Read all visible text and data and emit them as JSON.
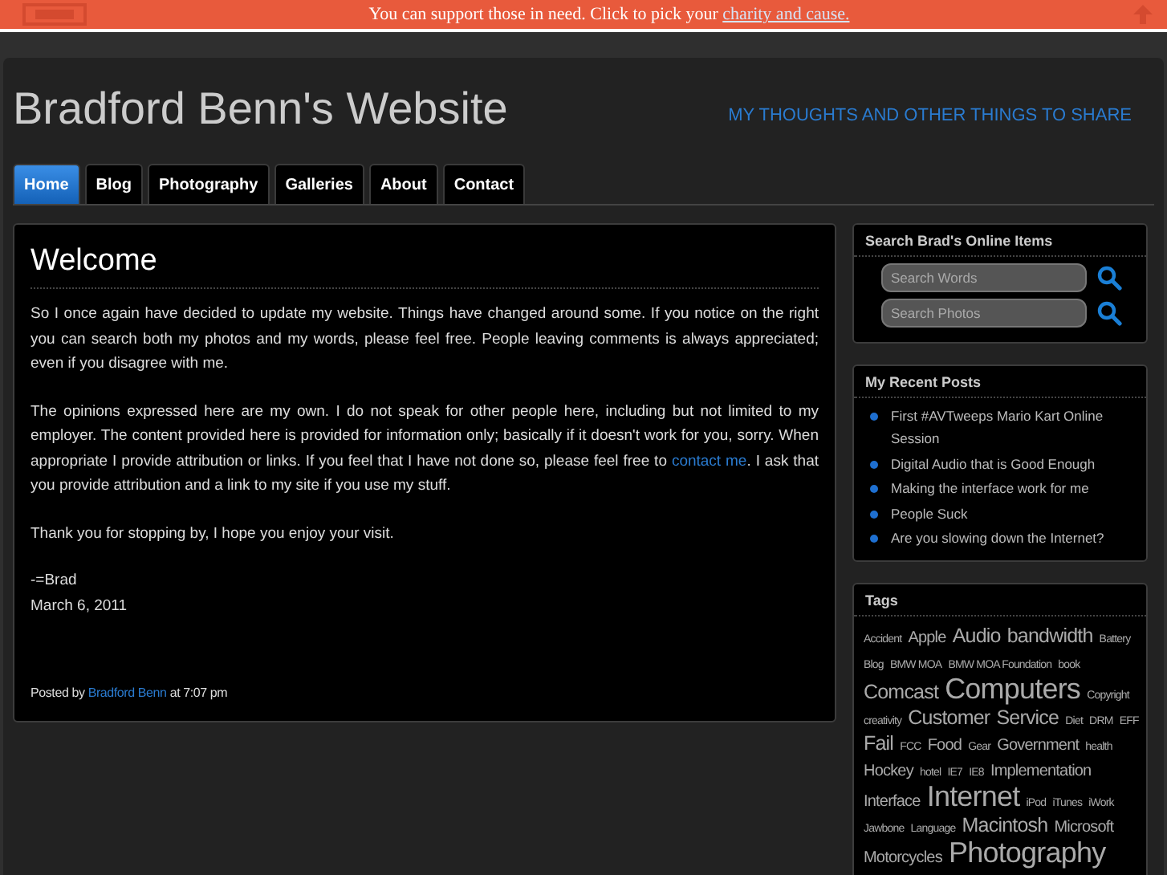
{
  "banner": {
    "text": "You can support those in need. Click to pick your ",
    "link": "charity and cause."
  },
  "header": {
    "title": "Bradford Benn's Website",
    "tagline": "MY THOUGHTS AND OTHER THINGS TO SHARE"
  },
  "tabs": [
    {
      "label": "Home",
      "selected": true
    },
    {
      "label": "Blog",
      "selected": false
    },
    {
      "label": "Photography",
      "selected": false
    },
    {
      "label": "Galleries",
      "selected": false
    },
    {
      "label": "About",
      "selected": false
    },
    {
      "label": "Contact",
      "selected": false
    }
  ],
  "post": {
    "title": "Welcome",
    "paragraphs": [
      [
        "So I once again have decided to update my website. Things have changed around some. If you notice on the right you can search both my photos and my words, please feel free. People leaving comments is always appreciated; even if you disagree with me."
      ],
      [
        "The opinions expressed here are my own. I do not speak for other people here, including but not limited to my employer. The content provided here is provided for information only; basically if it doesn't work for you, sorry. When appropriate I provide attribution or links. If you feel that I have not done so, please feel free to ",
        "contact me",
        ". I ask that you provide attribution and a link to my site if you use my stuff."
      ],
      [
        "Thank you for stopping by, I hope you enjoy your visit."
      ]
    ],
    "signature": [
      "-=Brad",
      "March 6, 2011"
    ],
    "footer": {
      "prefix": "Posted by ",
      "author": "Bradford Benn",
      "suffix": " at 7:07 pm"
    }
  },
  "search_widget": {
    "title": "Search Brad's Online Items",
    "fields": [
      {
        "placeholder": "Search Words"
      },
      {
        "placeholder": "Search Photos"
      }
    ]
  },
  "recent_posts": {
    "title": "My Recent Posts",
    "items": [
      "First #AVTweeps Mario Kart Online Session",
      "Digital Audio that is Good Enough",
      "Making the interface work for me",
      "People Suck",
      "Are you slowing down the Internet?"
    ]
  },
  "tags": {
    "title": "Tags",
    "items": [
      {
        "label": "Accident",
        "kind": "s"
      },
      {
        "label": "Apple",
        "kind": "m"
      },
      {
        "label": "Audio",
        "kind": "l"
      },
      {
        "label": "bandwidth",
        "kind": "l"
      },
      {
        "label": "Battery",
        "kind": "s"
      },
      {
        "label": "Blog",
        "kind": "s"
      },
      {
        "label": "BMW MOA",
        "kind": "s"
      },
      {
        "label": "BMW MOA Foundation",
        "kind": "s"
      },
      {
        "label": "book",
        "kind": "s"
      },
      {
        "label": "Comcast",
        "kind": "l"
      },
      {
        "label": "Computers",
        "kind": "xl"
      },
      {
        "label": "Copyright",
        "kind": "s"
      },
      {
        "label": "creativity",
        "kind": "s"
      },
      {
        "label": "Customer",
        "kind": "l"
      },
      {
        "label": "Service",
        "kind": "l"
      },
      {
        "label": "Diet",
        "kind": "s"
      },
      {
        "label": "DRM",
        "kind": "s"
      },
      {
        "label": "EFF",
        "kind": "s"
      },
      {
        "label": "Fail",
        "kind": "l"
      },
      {
        "label": "FCC",
        "kind": "s"
      },
      {
        "label": "Food",
        "kind": "m"
      },
      {
        "label": "Gear",
        "kind": "s"
      },
      {
        "label": "Government",
        "kind": "m"
      },
      {
        "label": "health",
        "kind": "s"
      },
      {
        "label": "Hockey",
        "kind": "m"
      },
      {
        "label": "hotel",
        "kind": "s"
      },
      {
        "label": "IE7",
        "kind": "s"
      },
      {
        "label": "IE8",
        "kind": "s"
      },
      {
        "label": "Implementation",
        "kind": "m"
      },
      {
        "label": "Interface",
        "kind": "m"
      },
      {
        "label": "Internet",
        "kind": "xl"
      },
      {
        "label": "iPod",
        "kind": "s"
      },
      {
        "label": "iTunes",
        "kind": "s"
      },
      {
        "label": "iWork",
        "kind": "s"
      },
      {
        "label": "Jawbone",
        "kind": "s"
      },
      {
        "label": "Language",
        "kind": "s"
      },
      {
        "label": "Macintosh",
        "kind": "l"
      },
      {
        "label": "Microsoft",
        "kind": "m"
      },
      {
        "label": "Motorcycles",
        "kind": "m"
      },
      {
        "label": "Photography",
        "kind": "xl"
      }
    ]
  }
}
